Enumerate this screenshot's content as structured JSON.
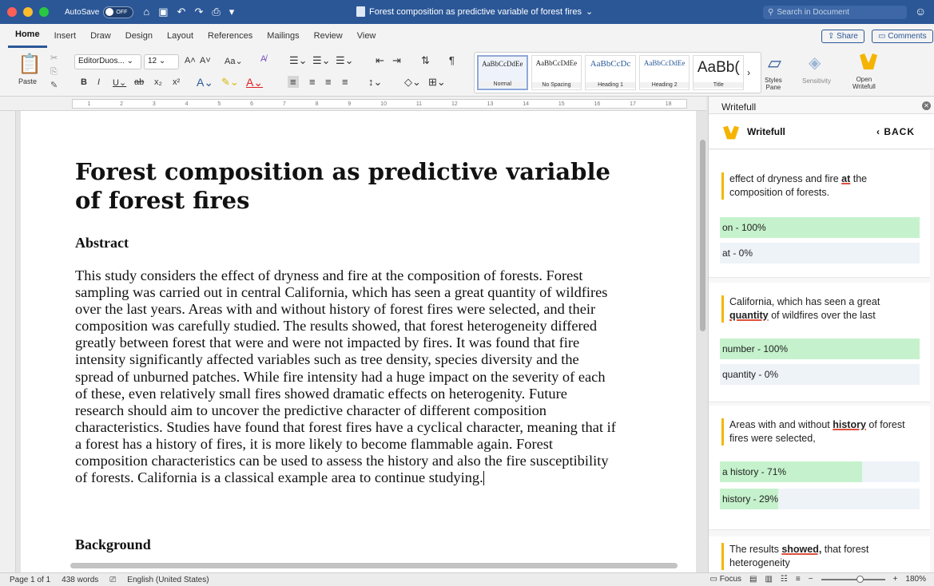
{
  "titlebar": {
    "autosave_label": "AutoSave",
    "autosave_state": "OFF",
    "document_title": "Forest composition as predictive variable of forest fires",
    "search_placeholder": "Search in Document"
  },
  "tabs": [
    "Home",
    "Insert",
    "Draw",
    "Design",
    "Layout",
    "References",
    "Mailings",
    "Review",
    "View"
  ],
  "actions": {
    "share": "Share",
    "comments": "Comments"
  },
  "ribbon": {
    "paste": "Paste",
    "font_name": "EditorDuos...",
    "font_size": "12",
    "styles": [
      {
        "sample": "AaBbCcDdEe",
        "name": "Normal"
      },
      {
        "sample": "AaBbCcDdEe",
        "name": "No Spacing"
      },
      {
        "sample": "AaBbCcDc",
        "name": "Heading 1"
      },
      {
        "sample": "AaBbCcDdEe",
        "name": "Heading 2"
      },
      {
        "sample": "AaBb(",
        "name": "Title"
      }
    ],
    "styles_pane": "Styles\nPane",
    "sensitivity": "Sensitivity",
    "open_writefull": "Open\nWritefull"
  },
  "ruler_numbers": [
    "1",
    "2",
    "3",
    "4",
    "5",
    "6",
    "7",
    "8",
    "9",
    "10",
    "11",
    "12",
    "13",
    "14",
    "15",
    "16",
    "17",
    "18"
  ],
  "document": {
    "title": "Forest composition as predictive variable of forest fires",
    "abstract_heading": "Abstract",
    "abstract_text": "This study considers the effect of dryness and fire at the composition of forests. Forest sampling was carried out in central California, which has seen a great quantity of wildfires over the last years. Areas with and without history of forest fires were selected, and their composition was carefully studied. The results showed, that forest heterogeneity differed greatly between forest that were and were not impacted by fires. It was found that fire intensity significantly affected variables such as tree density, species diversity and the spread of unburned patches. While fire intensity had a huge impact on the severity of each of these, even relatively small fires showed dramatic effects on heterogenity. Future research should aim to uncover the predictive character of different composition characteristics. Studies have found that forest fires have a cyclical character, meaning that if a forest has a history of fires, it is more likely to become flammable again. Forest composition characteristics can be used to assess the history and also the fire susceptibility of forests. California is a classical example area to continue studying.",
    "background_heading": "Background"
  },
  "pane": {
    "header": "Writefull",
    "brand": "Writefull",
    "back": "BACK",
    "cards": [
      {
        "before": "effect of dryness and fire ",
        "highlight": "at",
        "after": " the composition of forests.",
        "options": [
          {
            "label": "on - 100%",
            "pct": 100
          },
          {
            "label": "at - 0%",
            "pct": 0
          }
        ]
      },
      {
        "before": "California, which has seen a great ",
        "highlight": "quantity",
        "after": " of wildfires over the last",
        "options": [
          {
            "label": "number - 100%",
            "pct": 100
          },
          {
            "label": "quantity - 0%",
            "pct": 0
          }
        ]
      },
      {
        "before": "Areas with and without ",
        "highlight": "history",
        "after": " of forest fires were selected,",
        "options": [
          {
            "label": "a history - 71%",
            "pct": 71
          },
          {
            "label": "history - 29%",
            "pct": 29
          }
        ]
      },
      {
        "before": "The results ",
        "highlight": "showed,",
        "after": " that forest heterogeneity",
        "options": []
      }
    ]
  },
  "status": {
    "page": "Page 1 of 1",
    "words": "438 words",
    "language": "English (United States)",
    "focus": "Focus",
    "zoom": "180%",
    "zoom_fraction": 0.6
  },
  "colors": {
    "ribbon_blue": "#2b5797",
    "accent_green": "#c5f2cc",
    "highlight_bar": "#f0b800"
  }
}
